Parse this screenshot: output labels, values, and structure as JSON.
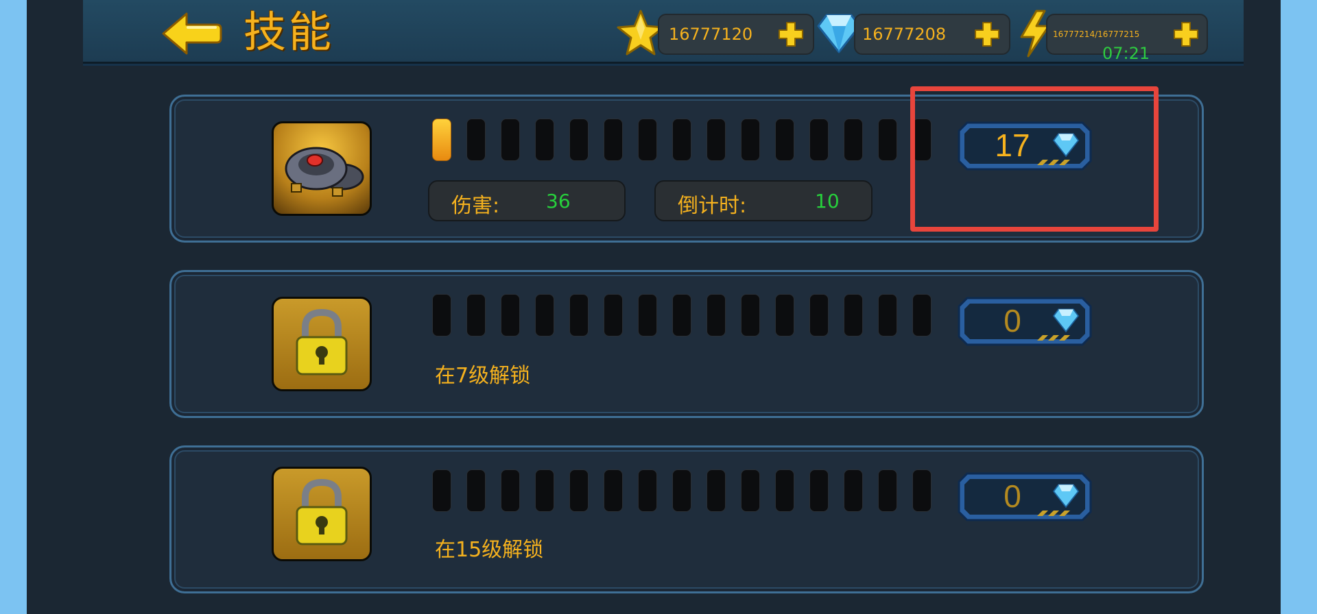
{
  "header": {
    "title": "技能",
    "gold": "16777120",
    "gems": "16777208",
    "energy": "16777214/16777215",
    "energy_timer": "07:21"
  },
  "skills": [
    {
      "level_filled": 1,
      "level_total": 15,
      "damage_label": "伤害:",
      "damage_value": "36",
      "countdown_label": "倒计时:",
      "countdown_value": "10",
      "cost": "17"
    },
    {
      "level_filled": 0,
      "level_total": 15,
      "unlock_text": "在7级解锁",
      "cost": "0"
    },
    {
      "level_filled": 0,
      "level_total": 15,
      "unlock_text": "在15级解锁",
      "cost": "0"
    }
  ],
  "colors": {
    "accent_gold": "#f6b21e",
    "value_green": "#27d13c",
    "highlight_red": "#e8453c"
  }
}
